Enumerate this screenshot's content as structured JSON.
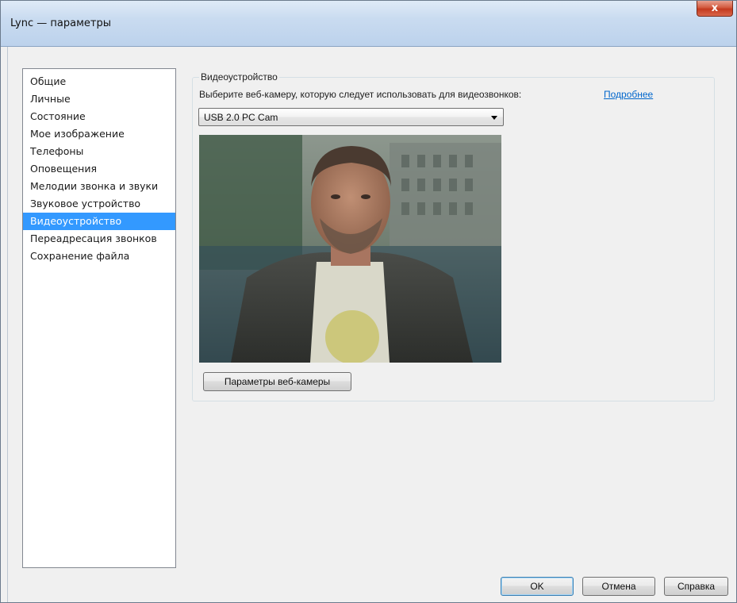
{
  "window": {
    "title": "Lync — параметры",
    "close_label": "x"
  },
  "sidebar": {
    "items": [
      {
        "label": "Общие"
      },
      {
        "label": "Личные"
      },
      {
        "label": "Состояние"
      },
      {
        "label": "Мое изображение"
      },
      {
        "label": "Телефоны"
      },
      {
        "label": "Оповещения"
      },
      {
        "label": "Мелодии звонка и звуки"
      },
      {
        "label": "Звуковое устройство"
      },
      {
        "label": "Видеоустройство"
      },
      {
        "label": "Переадресация звонков"
      },
      {
        "label": "Сохранение файла"
      }
    ],
    "selected_index": 8
  },
  "video_device": {
    "group_title": "Видеоустройство",
    "prompt": "Выберите веб-камеру, которую следует использовать для видеозвонков:",
    "more_link": "Подробнее",
    "selected_camera": "USB 2.0 PC Cam",
    "webcam_settings_button": "Параметры веб-камеры"
  },
  "footer": {
    "ok_label": "OK",
    "cancel_label": "Отмена",
    "help_label": "Справка"
  },
  "colors": {
    "selection": "#3399ff",
    "link": "#0066cc",
    "close_button": "#c43a1f"
  }
}
